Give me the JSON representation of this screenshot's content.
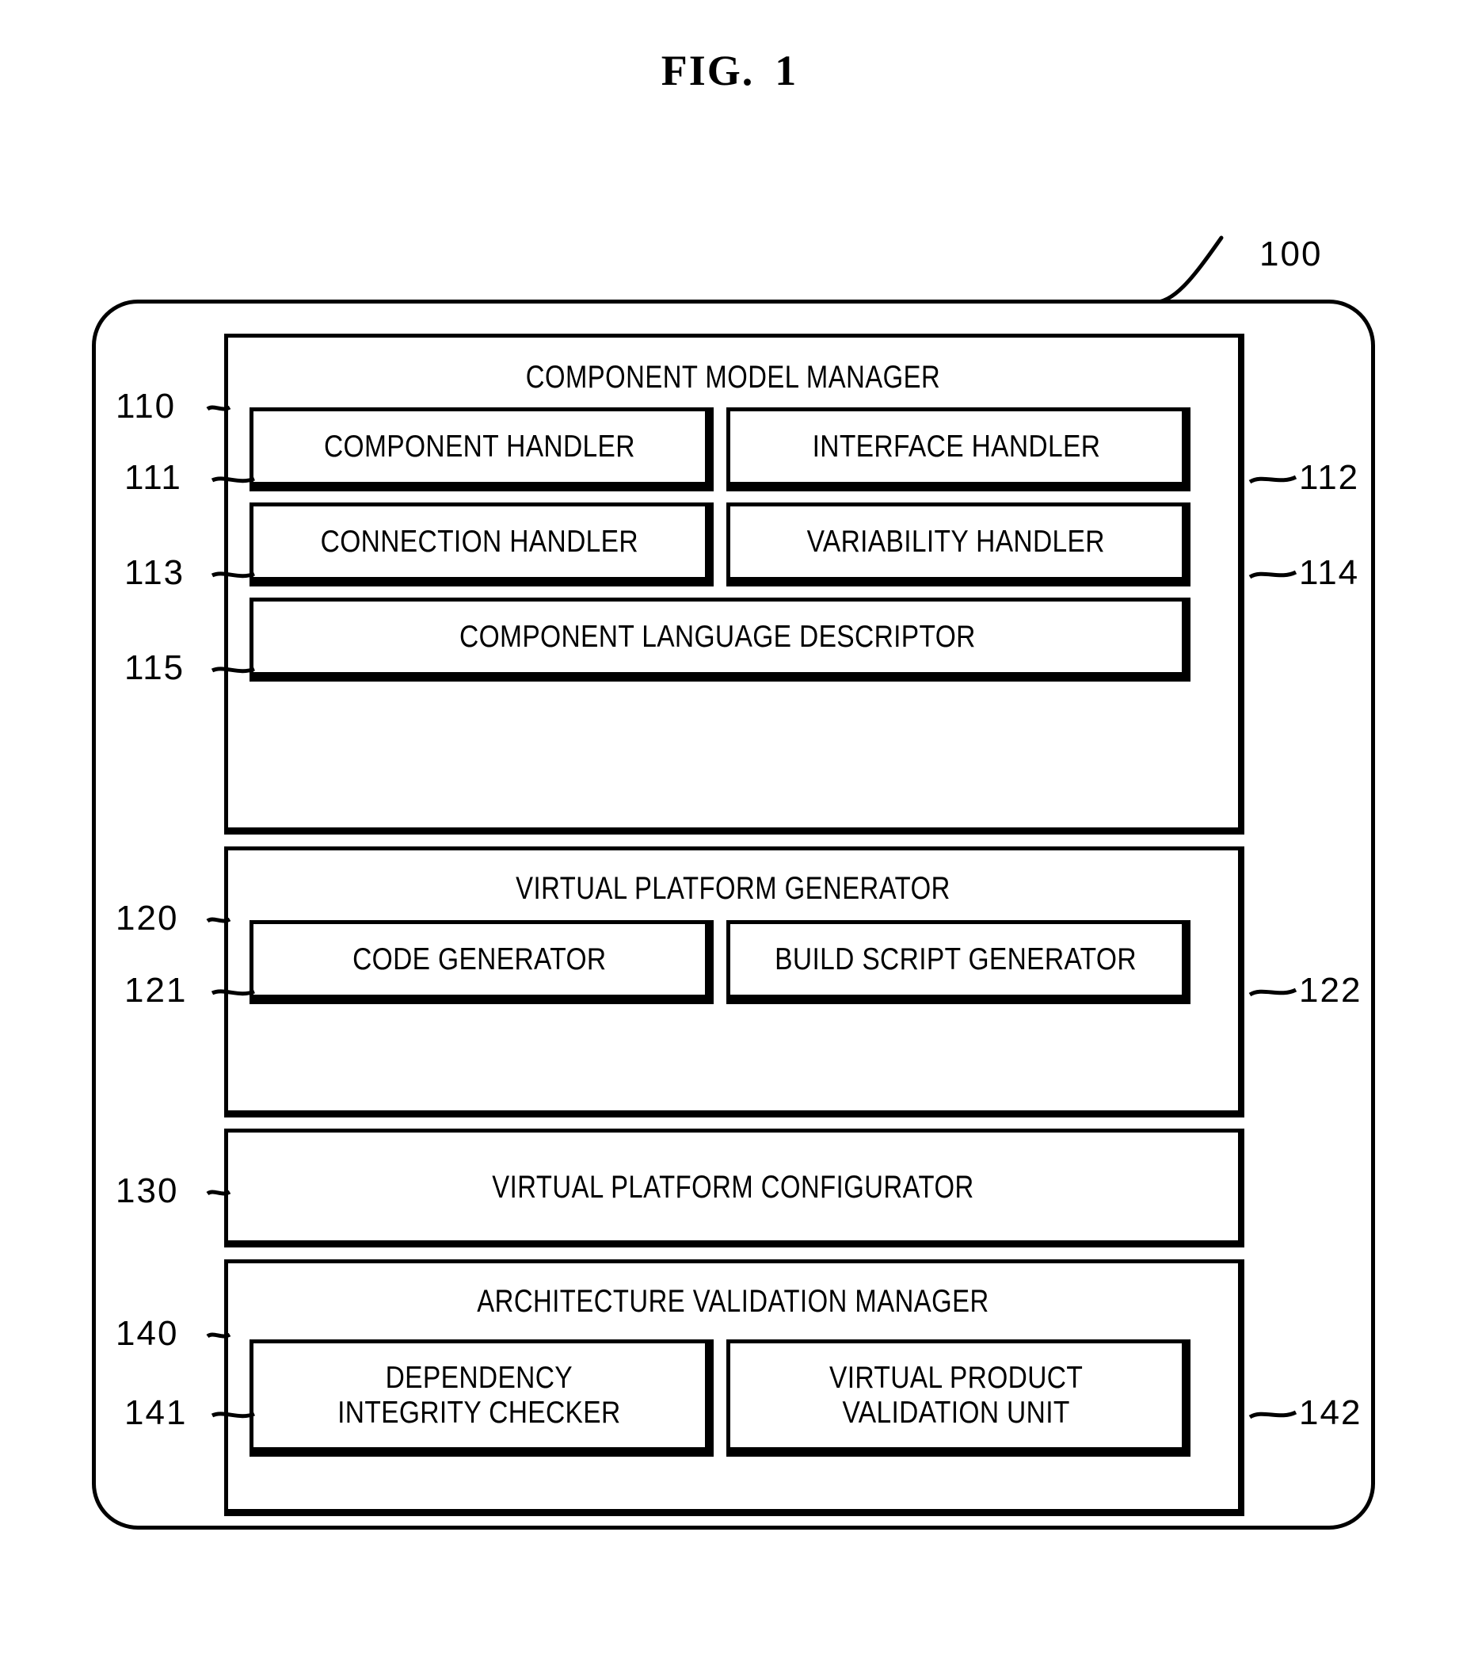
{
  "figure": {
    "title_prefix": "FIG.",
    "title_number": "1",
    "system_ref": "100"
  },
  "sections": [
    {
      "ref": "110",
      "title": "COMPONENT MODEL MANAGER",
      "units": [
        {
          "ref": "111",
          "ref_side": "left",
          "label_line1": "COMPONENT HANDLER",
          "label_line2": ""
        },
        {
          "ref": "112",
          "ref_side": "right",
          "label_line1": "INTERFACE HANDLER",
          "label_line2": ""
        },
        {
          "ref": "113",
          "ref_side": "left",
          "label_line1": "CONNECTION HANDLER",
          "label_line2": ""
        },
        {
          "ref": "114",
          "ref_side": "right",
          "label_line1": "VARIABILITY HANDLER",
          "label_line2": ""
        },
        {
          "ref": "115",
          "ref_side": "left",
          "label_line1": "COMPONENT LANGUAGE DESCRIPTOR",
          "label_line2": ""
        }
      ]
    },
    {
      "ref": "120",
      "title": "VIRTUAL PLATFORM GENERATOR",
      "units": [
        {
          "ref": "121",
          "ref_side": "left",
          "label_line1": "CODE GENERATOR",
          "label_line2": ""
        },
        {
          "ref": "122",
          "ref_side": "right",
          "label_line1": "BUILD SCRIPT GENERATOR",
          "label_line2": ""
        }
      ]
    },
    {
      "ref": "130",
      "title": "VIRTUAL PLATFORM CONFIGURATOR",
      "units": []
    },
    {
      "ref": "140",
      "title": "ARCHITECTURE VALIDATION MANAGER",
      "units": [
        {
          "ref": "141",
          "ref_side": "left",
          "label_line1": "DEPENDENCY",
          "label_line2": "INTEGRITY CHECKER"
        },
        {
          "ref": "142",
          "ref_side": "right",
          "label_line1": "VIRTUAL PRODUCT",
          "label_line2": "VALIDATION UNIT"
        }
      ]
    }
  ],
  "colors": {
    "ink": "#000000",
    "paper": "#ffffff"
  }
}
